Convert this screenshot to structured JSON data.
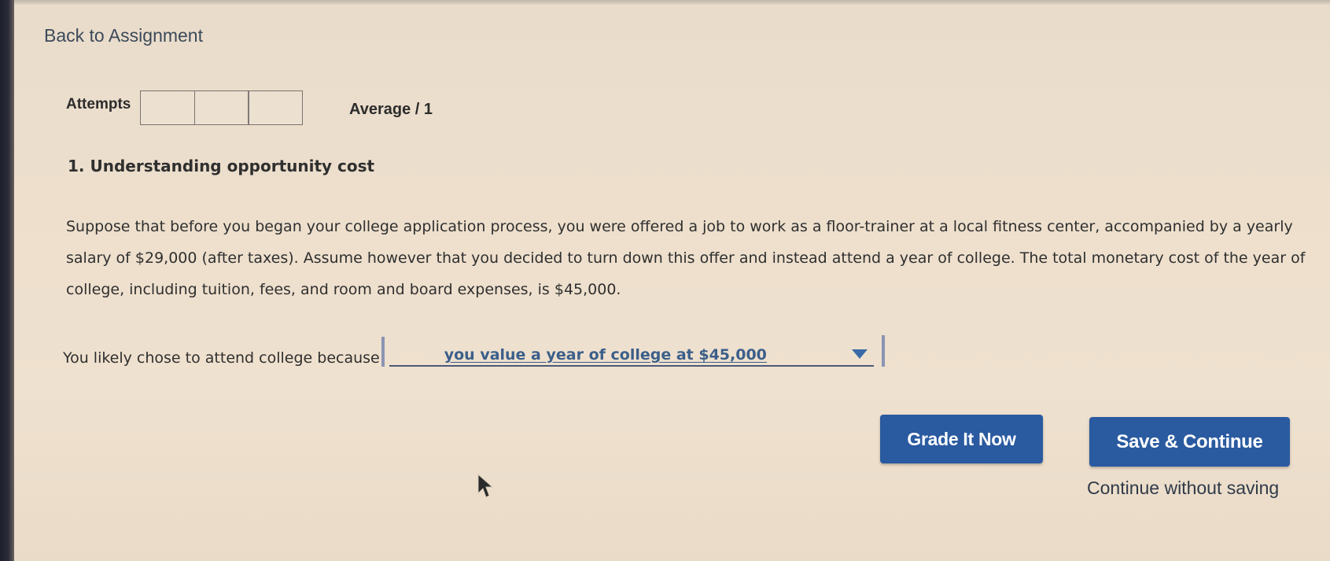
{
  "nav": {
    "back_label": "Back to Assignment"
  },
  "attempts": {
    "label": "Attempts",
    "box_count": 3,
    "average_text": "Average / 1"
  },
  "question": {
    "title": "1. Understanding opportunity cost",
    "body": "Suppose that before you began your college application process, you were offered a job to work as a floor-trainer at a local fitness center, accompanied by a yearly salary of $29,000 (after taxes). Assume however that you decided to turn down this offer and instead attend a year of college. The total monetary cost of the year of college, including tuition, fees, and room and board expenses, is $45,000.",
    "prompt": "You likely chose to attend college because",
    "dropdown": {
      "selected": "you value a year of college at $45,000",
      "icon": "chevron-down-icon"
    }
  },
  "actions": {
    "grade_label": "Grade It Now",
    "save_label": "Save & Continue",
    "continue_label": "Continue without saving"
  },
  "colors": {
    "background": "#eddfcc",
    "button": "#2a5aa0",
    "dropdown_text": "#3b5f8a"
  }
}
